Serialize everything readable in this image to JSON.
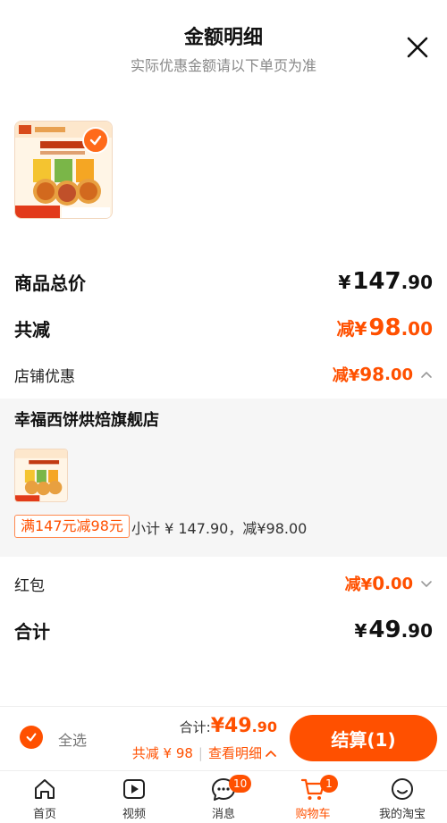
{
  "header": {
    "title": "金额明细",
    "subtitle": "实际优惠金额请以下单页为准"
  },
  "product": {
    "image_alt": "新品比萨套装"
  },
  "summary": {
    "goods_total_label": "商品总价",
    "goods_total_yen": "¥",
    "goods_total_int": "147",
    "goods_total_dec": ".90",
    "total_discount_label": "共减",
    "total_discount_prefix": "减¥",
    "total_discount_int": "98",
    "total_discount_dec": ".00",
    "store_discount_label": "店铺优惠",
    "store_discount_prefix": "减¥",
    "store_discount_int": "98",
    "store_discount_dec": ".00",
    "red_packet_label": "红包",
    "red_packet_prefix": "减¥",
    "red_packet_int": "0",
    "red_packet_dec": ".00",
    "sum_label": "合计",
    "sum_yen": "¥",
    "sum_int": "49",
    "sum_dec": ".90"
  },
  "store": {
    "name": "幸福西饼烘焙旗舰店",
    "promo_tag": "满147元减98元",
    "subtotal": "小计 ¥ 147.90，减¥98.00"
  },
  "footer": {
    "select_all": "全选",
    "total_label": "合计:",
    "total_yen": "¥",
    "total_int": "49",
    "total_dec": ".90",
    "discount_text": "共减 ¥ 98",
    "sep": "|",
    "view_detail": "查看明细",
    "checkout": "结算(1)"
  },
  "tabs": [
    {
      "label": "首页",
      "icon": "home-icon"
    },
    {
      "label": "视频",
      "icon": "video-icon"
    },
    {
      "label": "消息",
      "icon": "message-icon",
      "badge": "10"
    },
    {
      "label": "购物车",
      "icon": "cart-icon",
      "badge": "1",
      "active": true
    },
    {
      "label": "我的淘宝",
      "icon": "profile-icon"
    }
  ],
  "colors": {
    "accent": "#ff5000",
    "muted": "#888888"
  }
}
